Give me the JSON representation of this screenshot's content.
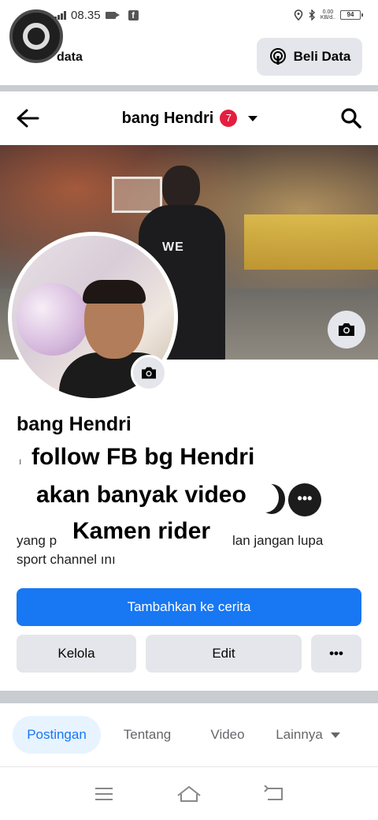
{
  "status_bar": {
    "network": "4G",
    "time": "08.35",
    "speed_value": "0.00",
    "speed_unit": "KB/d..",
    "battery": "94"
  },
  "data_bar": {
    "label": "data",
    "buy_button": "Beli Data"
  },
  "nav": {
    "title": "bang Hendri",
    "badge_count": "7"
  },
  "cover": {
    "jersey_text": "WE"
  },
  "profile": {
    "name": "bang Hendri",
    "overlay_lines": [
      "follow FB bg Hendri",
      "akan banyak video",
      "Kamen rider"
    ],
    "bio_left": "yang p",
    "bio_right": "lan jangan lupa",
    "bio_line2": "sport channel ını",
    "more_label": "•••"
  },
  "buttons": {
    "add_story": "Tambahkan ke cerita",
    "manage": "Kelola",
    "edit": "Edit",
    "more": "•••"
  },
  "tabs": [
    {
      "label": "Postingan",
      "active": true
    },
    {
      "label": "Tentang",
      "active": false
    },
    {
      "label": "Video",
      "active": false
    },
    {
      "label": "Lainnya",
      "active": false
    }
  ],
  "colors": {
    "primary": "#1877f2",
    "badge": "#e41e3f",
    "button_gray": "#e4e6eb",
    "active_tab_bg": "#e7f3ff"
  },
  "icons": [
    "signal-icon",
    "video-icon",
    "facebook-icon",
    "location-icon",
    "bluetooth-icon",
    "battery-icon",
    "broadcast-icon",
    "back-arrow-icon",
    "search-icon",
    "camera-icon",
    "menu-icon",
    "home-icon",
    "back-icon"
  ]
}
